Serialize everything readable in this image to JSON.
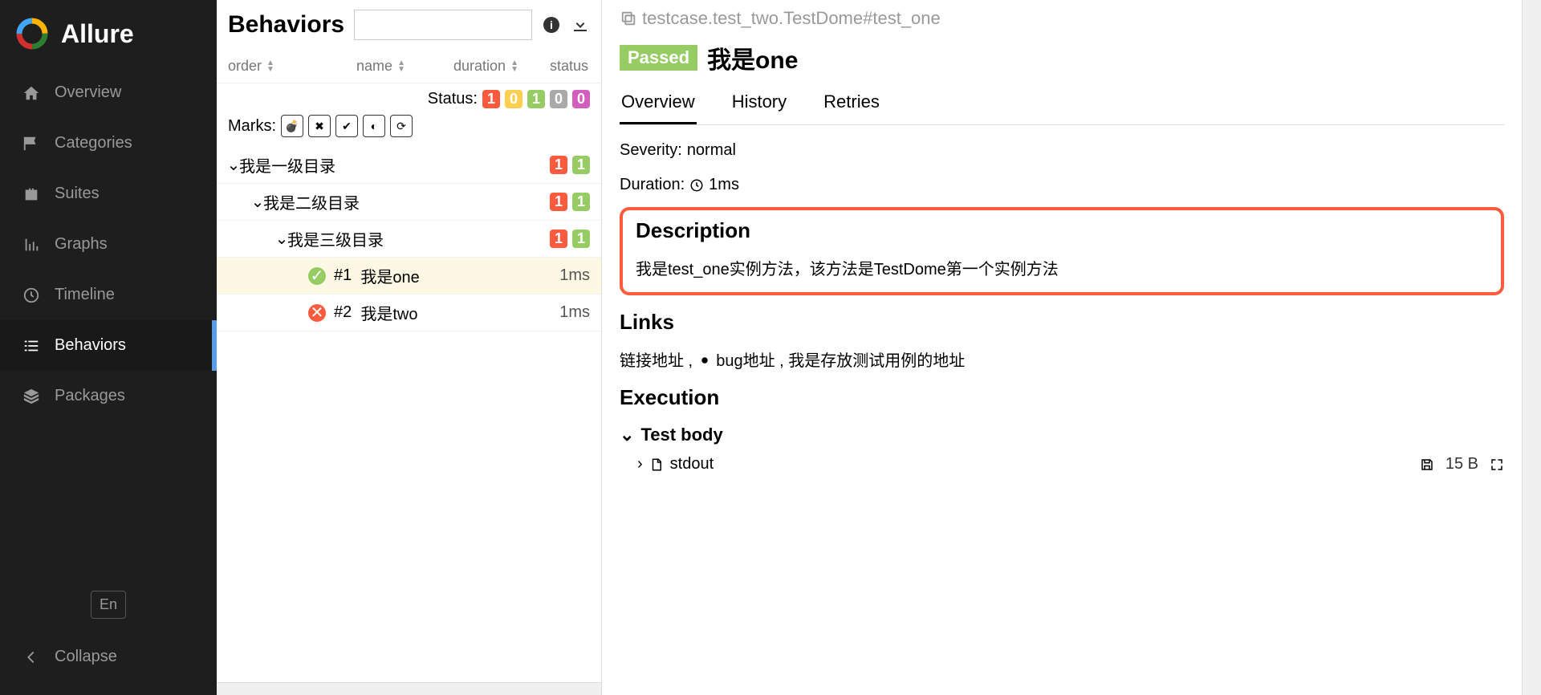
{
  "brand": "Allure",
  "nav": {
    "items": [
      {
        "label": "Overview",
        "icon": "home"
      },
      {
        "label": "Categories",
        "icon": "flag"
      },
      {
        "label": "Suites",
        "icon": "briefcase"
      },
      {
        "label": "Graphs",
        "icon": "chart"
      },
      {
        "label": "Timeline",
        "icon": "clock"
      },
      {
        "label": "Behaviors",
        "icon": "list"
      },
      {
        "label": "Packages",
        "icon": "layers"
      }
    ],
    "lang": "En",
    "collapse": "Collapse"
  },
  "middle": {
    "title": "Behaviors",
    "columns": {
      "order": "order",
      "name": "name",
      "duration": "duration",
      "status": "status"
    },
    "status_label": "Status:",
    "status_counts": [
      "1",
      "0",
      "1",
      "0",
      "0"
    ],
    "marks_label": "Marks:",
    "tree": {
      "l1": {
        "label": "我是一级目录",
        "badges": [
          "1",
          "1"
        ]
      },
      "l2": {
        "label": "我是二级目录",
        "badges": [
          "1",
          "1"
        ]
      },
      "l3": {
        "label": "我是三级目录",
        "badges": [
          "1",
          "1"
        ]
      },
      "leaf1": {
        "num": "#1",
        "label": "我是one",
        "duration": "1ms"
      },
      "leaf2": {
        "num": "#2",
        "label": "我是two",
        "duration": "1ms"
      }
    }
  },
  "right": {
    "breadcrumb": "testcase.test_two.TestDome#test_one",
    "status_badge": "Passed",
    "title": "我是one",
    "tabs": {
      "overview": "Overview",
      "history": "History",
      "retries": "Retries"
    },
    "severity_label": "Severity: ",
    "severity": "normal",
    "duration_label": "Duration:",
    "duration": "1ms",
    "description_h": "Description",
    "description": "我是test_one实例方法，该方法是TestDome第一个实例方法",
    "links_h": "Links",
    "links_text_1": "链接地址 , ",
    "links_text_2": " bug地址 , 我是存放测试用例的地址",
    "execution_h": "Execution",
    "test_body": "Test body",
    "stdout": "stdout",
    "stdout_size": "15 B"
  }
}
